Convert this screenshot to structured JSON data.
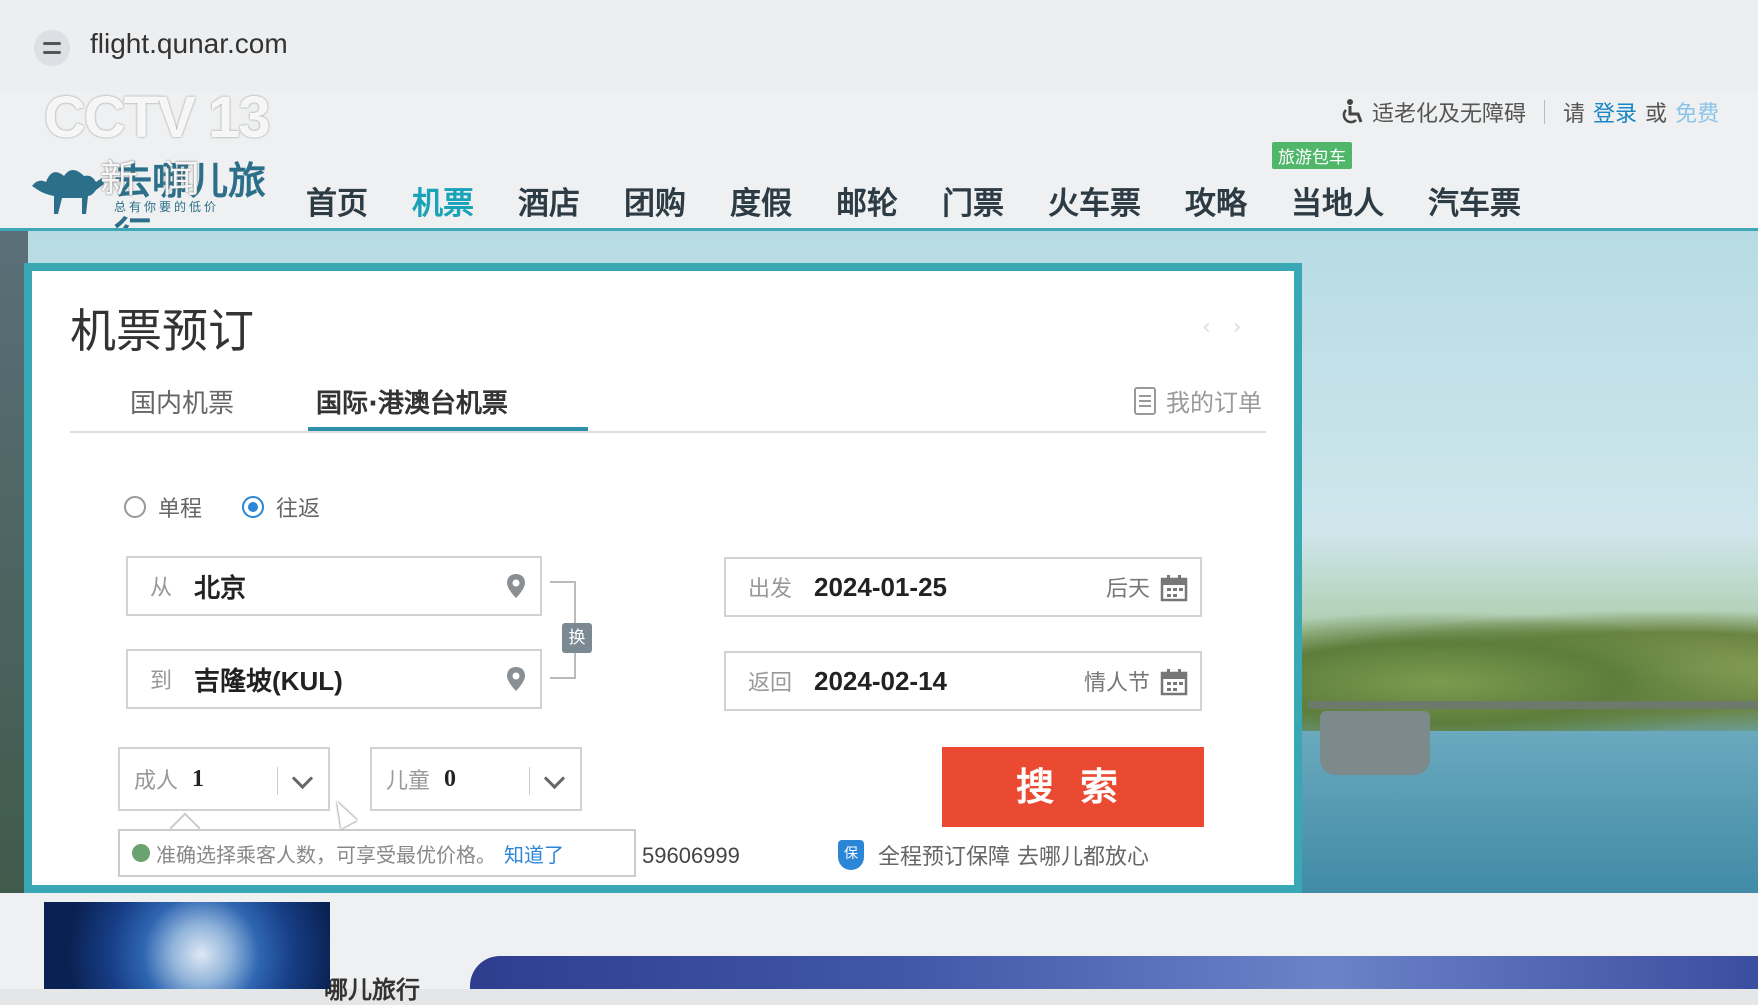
{
  "browser": {
    "url": "flight.qunar.com"
  },
  "overlay": {
    "channel": "CCTV 13",
    "program": "新 闻"
  },
  "site": {
    "brand": "去哪儿旅行",
    "slogan": "总有你要的低价",
    "nav": [
      "首页",
      "机票",
      "酒店",
      "团购",
      "度假",
      "邮轮",
      "门票",
      "火车票",
      "攻略",
      "当地人",
      "汽车票"
    ],
    "nav_active_index": 1,
    "nav_badge": "旅游包车",
    "top_links": {
      "accessibility": "适老化及无障碍",
      "please": "请",
      "login": "登录",
      "or": "或",
      "register": "免费"
    }
  },
  "booking": {
    "title": "机票预订",
    "tabs": [
      "国内机票",
      "国际·港澳台机票"
    ],
    "active_tab": 1,
    "my_orders": "我的订单",
    "trip_types": [
      "单程",
      "往返"
    ],
    "selected_trip_type": "往返",
    "from": {
      "label": "从",
      "value": "北京"
    },
    "to": {
      "label": "到",
      "value": "吉隆坡(KUL)"
    },
    "swap_label": "换",
    "depart": {
      "label": "出发",
      "value": "2024-01-25",
      "hint": "后天"
    },
    "return": {
      "label": "返回",
      "value": "2024-02-14",
      "hint": "情人节"
    },
    "adults": {
      "label": "成人",
      "value": "1"
    },
    "children": {
      "label": "儿童",
      "value": "0"
    },
    "search_label": "搜索",
    "tip": {
      "text": "准确选择乘客人数，可享受最优价格。",
      "ok": "知道了"
    },
    "phone": "59606999",
    "guarantee": {
      "icon": "保",
      "text": "全程预订保障 去哪儿都放心"
    }
  },
  "footer": {
    "partial_text": "哪儿旅行"
  }
}
